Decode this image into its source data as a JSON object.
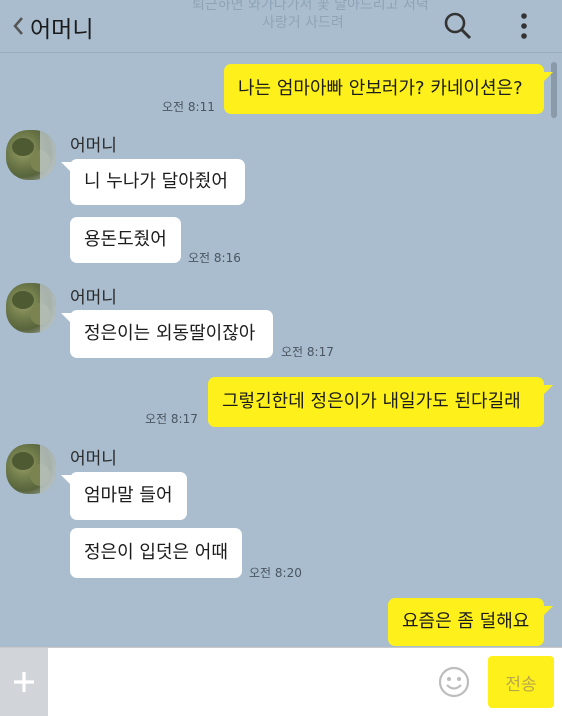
{
  "header": {
    "title": "어머니",
    "ghost_line1": "퇴근하면 와가다가서 꽃 달아드리고 저녁",
    "ghost_line2": "사랑거 사드려"
  },
  "colors": {
    "background": "#a9bdce",
    "my_bubble": "#fef01b",
    "their_bubble": "#ffffff"
  },
  "messages": [
    {
      "side": "me",
      "text": "나는 엄마아빠 안보러가? 카네이션은?",
      "time": "오전 8:11"
    },
    {
      "side": "them",
      "sender": "어머니",
      "text": "니 누나가 달아줬어"
    },
    {
      "side": "them",
      "text": "용돈도줬어",
      "time": "오전 8:16"
    },
    {
      "side": "them",
      "sender": "어머니",
      "text": "정은이는 외동딸이잖아",
      "time": "오전 8:17"
    },
    {
      "side": "me",
      "text": "그렇긴한데 정은이가 내일가도 된다길래",
      "time": "오전 8:17"
    },
    {
      "side": "them",
      "sender": "어머니",
      "text": "엄마말 들어"
    },
    {
      "side": "them",
      "text": "정은이 입덧은 어때",
      "time": "오전 8:20"
    },
    {
      "side": "me",
      "text": "요즘은 좀 덜해요"
    }
  ],
  "composer": {
    "input_value": "",
    "send_label": "전송"
  },
  "icons": [
    "back-chevron-icon",
    "search-icon",
    "more-vertical-icon",
    "avatar",
    "plus-icon",
    "emoji-icon"
  ]
}
